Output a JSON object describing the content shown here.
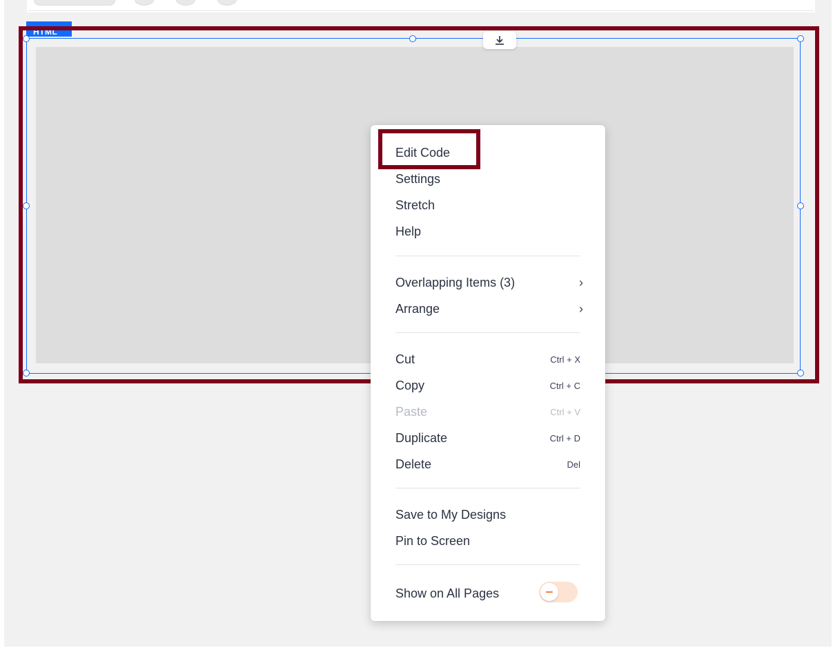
{
  "editor": {
    "element_tag": "HTML"
  },
  "context_menu": {
    "groups": [
      [
        {
          "label": "Edit Code"
        },
        {
          "label": "Settings"
        },
        {
          "label": "Stretch"
        },
        {
          "label": "Help"
        }
      ],
      [
        {
          "label": "Overlapping Items (3)",
          "submenu": true
        },
        {
          "label": "Arrange",
          "submenu": true
        }
      ],
      [
        {
          "label": "Cut",
          "shortcut": "Ctrl + X"
        },
        {
          "label": "Copy",
          "shortcut": "Ctrl + C"
        },
        {
          "label": "Paste",
          "shortcut": "Ctrl + V",
          "disabled": true
        },
        {
          "label": "Duplicate",
          "shortcut": "Ctrl + D"
        },
        {
          "label": "Delete",
          "shortcut": "Del"
        }
      ],
      [
        {
          "label": "Save to My Designs"
        },
        {
          "label": "Pin to Screen"
        }
      ],
      [
        {
          "label": "Show on All Pages",
          "toggle": "off"
        }
      ]
    ],
    "submenu_icon": "chevron-right-icon"
  },
  "colors": {
    "selection_blue": "#116dff",
    "annotation_red": "#7d0219",
    "toggle_off": "#f97b3f"
  }
}
